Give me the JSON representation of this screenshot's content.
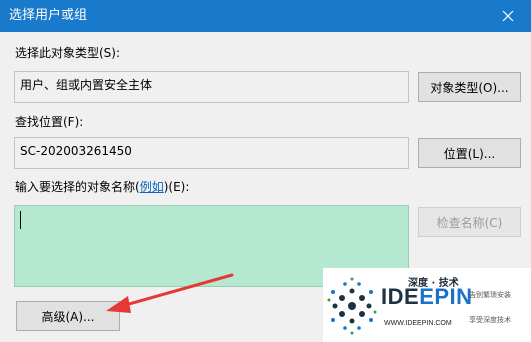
{
  "window": {
    "title": "选择用户或组"
  },
  "object_type": {
    "label": "选择此对象类型(S):",
    "value": "用户、组或内置安全主体",
    "button": "对象类型(O)..."
  },
  "location": {
    "label": "查找位置(F):",
    "value": "SC-202003261450",
    "button": "位置(L)..."
  },
  "names": {
    "label_prefix": "输入要选择的对象名称(",
    "label_link": "例如",
    "label_suffix": ")(E):",
    "value": "",
    "check_button": "检查名称(C)"
  },
  "advanced_button": "高级(A)...",
  "watermark": {
    "brand_cn": "深度 · 技术",
    "brand_ide": "IDE",
    "brand_epin": "EPIN",
    "url": "WWW.IDEEPIN.COM",
    "tagline_1": "告别繁琐安装",
    "tagline_2": "享受深度技术"
  },
  "colors": {
    "titlebar": "#1979ca",
    "input_highlight": "#b5e8d0",
    "arrow": "#e53935",
    "link": "#0b62c1"
  }
}
